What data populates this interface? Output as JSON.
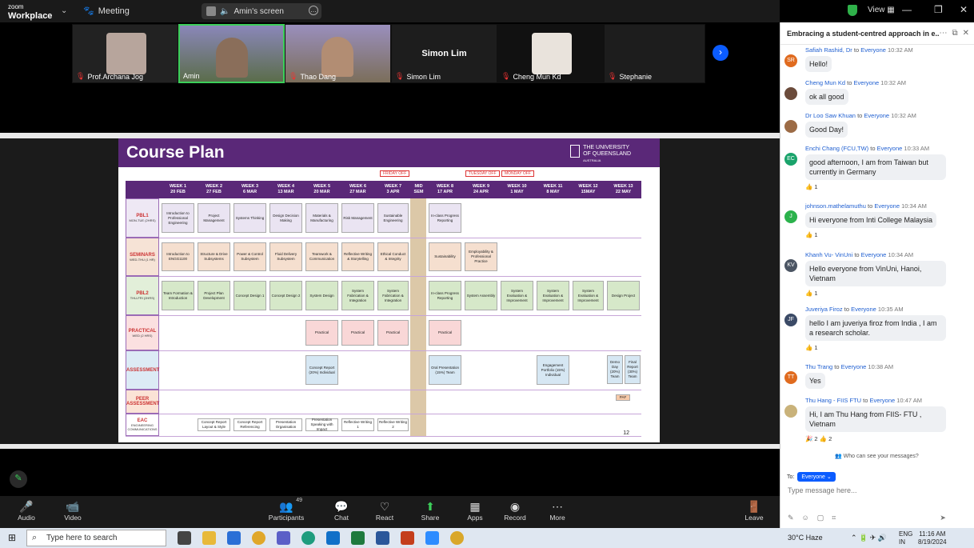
{
  "app": {
    "brand_top": "zoom",
    "brand_bottom": "Workplace",
    "meeting_label": "Meeting",
    "screen_label": "Amin's screen",
    "view_label": "View"
  },
  "participants": [
    {
      "name": "Prof.Archana Jog"
    },
    {
      "name": "Amin"
    },
    {
      "name": "Thao Dang"
    },
    {
      "name": "Simon Lim",
      "display": "Simon Lim"
    },
    {
      "name": "Cheng Mun Kd"
    },
    {
      "name": "Stephanie"
    }
  ],
  "slide": {
    "title": "Course Plan",
    "uni": [
      "THE UNIVERSITY",
      "OF QUEENSLAND",
      "AUSTRALIA"
    ],
    "off_tags": [
      "FRIDAY OFF",
      "TUESDAY OFF",
      "MONDAY OFF"
    ],
    "weeks": [
      {
        "w": "WEEK 1",
        "d": "20 FEB"
      },
      {
        "w": "WEEK 2",
        "d": "27 FEB"
      },
      {
        "w": "WEEK 3",
        "d": "6 MAR"
      },
      {
        "w": "WEEK 4",
        "d": "13 MAR"
      },
      {
        "w": "WEEK 5",
        "d": "20 MAR"
      },
      {
        "w": "WEEK 6",
        "d": "27 MAR"
      },
      {
        "w": "WEEK 7",
        "d": "3 APR"
      },
      {
        "w": "MID",
        "d": "SEM"
      },
      {
        "w": "WEEK 8",
        "d": "17 APR"
      },
      {
        "w": "WEEK 9",
        "d": "24 APR"
      },
      {
        "w": "WEEK 10",
        "d": "1 MAY"
      },
      {
        "w": "WEEK 11",
        "d": "8 MAY"
      },
      {
        "w": "WEEK 12",
        "d": "15MAY"
      },
      {
        "w": "WEEK 13",
        "d": "22 MAY"
      }
    ],
    "rows": [
      {
        "t": "PBL1",
        "s": "MON-TUE (2HRS)"
      },
      {
        "t": "SEMINARS",
        "s": "WED-THU (1 HR)"
      },
      {
        "t": "PBL2",
        "s": "THU-FRI (2HRS)"
      },
      {
        "t": "PRACTICAL",
        "s": "WED (2 HRS)"
      },
      {
        "t": "ASSESSMENT",
        "s": ""
      },
      {
        "t": "PEER ASSESSMENT",
        "s": ""
      },
      {
        "t": "EAC",
        "s": "ENGINEERING COMMUNICATIONS"
      }
    ],
    "pbl1": [
      "Introduction to Professional Engineering",
      "Project Management",
      "Systems Thinking",
      "Design Decision Making",
      "Materials & Manufacturing",
      "Risk Management",
      "Sustainable Engineering",
      "In-class Progress Reporting"
    ],
    "seminars": [
      "Introduction to ENGG1100",
      "Structure & Drive Subsystems",
      "Power & Control Subsystem",
      "Fluid Delivery Subsystem",
      "Teamwork & Communication",
      "Reflective Writing & Storytelling",
      "Ethical Conduct & Integrity",
      "Sustainability",
      "Employability & Professional Practice"
    ],
    "pbl2": [
      "Team Formation & Introduction",
      "Project Plan Development",
      "Concept Design 1",
      "Concept Design 2",
      "System Design",
      "System Fabrication & Integration",
      "System Fabrication & Integration",
      "In-class Progress Reporting",
      "System Assembly",
      "System Evaluation & Improvement",
      "System Evaluation & Improvement",
      "System Evaluation & Improvement",
      "Design Project"
    ],
    "practical": [
      "Practical",
      "Practical",
      "Practical",
      "Practical"
    ],
    "assessment": [
      "Concept Report (20%) Individual",
      "Oral Presentation (15%) Team",
      "Engagement Portfolio (15%) Individual",
      "Demo Day (20%) Team",
      "Final Report (30%) Team"
    ],
    "peer": "PAF",
    "eac": [
      "Concept Report Layout & Style",
      "Concept Report Referencing",
      "Presentation Organisation",
      "Presentation Speaking with Impact",
      "Reflective Writing 1",
      "Reflective Writing 2"
    ],
    "page": "12"
  },
  "chat": {
    "title": "Embracing a student-centred approach in e...",
    "messages": [
      {
        "from": "Safiah Rashid, Dr",
        "to": "Everyone",
        "time": "10:32 AM",
        "text": "Hello!",
        "initials": "SR",
        "color": "#e06b1f",
        "react": ""
      },
      {
        "from": "Cheng Mun Kd",
        "to": "Everyone",
        "time": "10:32 AM",
        "text": "ok all good",
        "initials": "",
        "color": "#6b4b3b",
        "react": ""
      },
      {
        "from": "Dr Loo Saw Khuan",
        "to": "Everyone",
        "time": "10:32 AM",
        "text": "Good Day!",
        "initials": "",
        "color": "#9c6b45",
        "react": ""
      },
      {
        "from": "Enchi Chang (FCU,TW)",
        "to": "Everyone",
        "time": "10:33 AM",
        "text": "good afternoon, I am from Taiwan but currently in Germany",
        "initials": "EC",
        "color": "#1aa36b",
        "react": "👍 1"
      },
      {
        "from": "johnson.mathelamuthu",
        "to": "Everyone",
        "time": "10:34 AM",
        "text": "Hi everyone from Inti College Malaysia",
        "initials": "J",
        "color": "#2bb24c",
        "react": "👍 1"
      },
      {
        "from": "Khanh Vu- VinUni",
        "to": "Everyone",
        "time": "10:34 AM",
        "text": "Hello everyone from VinUni, Hanoi, Vietnam",
        "initials": "KV",
        "color": "#4b5563",
        "react": "👍 1"
      },
      {
        "from": "Juveriya Firoz",
        "to": "Everyone",
        "time": "10:35 AM",
        "text": "hello I am juveriya firoz from India , I am a research scholar.",
        "initials": "JF",
        "color": "#3b4a66",
        "react": "👍 1"
      },
      {
        "from": "Thu Trang",
        "to": "Everyone",
        "time": "10:38 AM",
        "text": "Yes",
        "initials": "TT",
        "color": "#e06b1f",
        "react": ""
      },
      {
        "from": "Thu Hang - FIIS FTU",
        "to": "Everyone",
        "time": "10:47 AM",
        "text": "Hi, I am Thu Hang from FIIS- FTU , Vietnam",
        "initials": "",
        "color": "#c9b27a",
        "react": "🎉 2   👍 2"
      }
    ],
    "who_can_see": "Who can see your messages?",
    "to_label": "To:",
    "to_value": "Everyone",
    "placeholder": "Type message here..."
  },
  "toolbar": [
    {
      "label": "Audio",
      "icon": "🎤",
      "badge": ""
    },
    {
      "label": "Video",
      "icon": "📹",
      "badge": ""
    },
    {
      "label": "Participants",
      "icon": "👥",
      "badge": "49"
    },
    {
      "label": "Chat",
      "icon": "💬",
      "badge": ""
    },
    {
      "label": "React",
      "icon": "♡",
      "badge": ""
    },
    {
      "label": "Share",
      "icon": "⬆",
      "badge": ""
    },
    {
      "label": "Apps",
      "icon": "▦",
      "badge": ""
    },
    {
      "label": "Record",
      "icon": "◉",
      "badge": ""
    },
    {
      "label": "More",
      "icon": "⋯",
      "badge": ""
    },
    {
      "label": "Leave",
      "icon": "🚪",
      "badge": ""
    }
  ],
  "taskbar": {
    "search": "Type here to search",
    "weather": "30°C  Haze",
    "lang": "ENG IN",
    "time": "11:16 AM",
    "date": "8/19/2024"
  }
}
